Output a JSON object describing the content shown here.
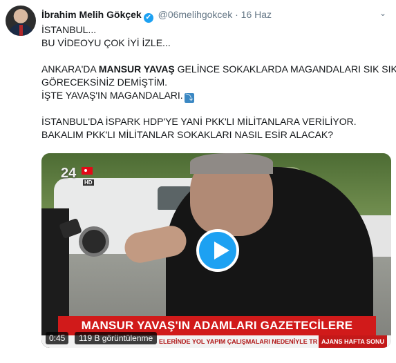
{
  "tweet": {
    "author_name": "İbrahim Melih Gökçek",
    "handle": "@06melihgokcek",
    "separator": "·",
    "date": "16 Haz",
    "verified_glyph": "✔",
    "menu_glyph": "⌄",
    "lines": [
      "İSTANBUL...",
      "BU VİDEOYU ÇOK İYİ İZLE...",
      "",
      "",
      "GÖRECEKSİNİZ DEMİŞTİM.",
      "İŞTE YAVAŞ'IN MAGANDALARI.",
      "",
      "İSTANBUL'DA İSPARK HDP'YE YANİ PKK'LI MİLİTANLARA VERİLİYOR.",
      "BAKALIM PKK'LI MİLİTANLAR SOKAKLARI NASIL ESİR ALACAK?"
    ],
    "line3_prefix": "ANKARA'DA ",
    "line3_bold": "MANSUR YAVAŞ",
    "line3_suffix": " GELİNCE SOKAKLARDA MAGANDALARI SIK SIK",
    "emoji_glyph": "⤵"
  },
  "video": {
    "channel_number": "24",
    "channel_hd": "HD",
    "headline": "MANSUR YAVAŞ'IN ADAMLARI GAZETECİLERE SALDIRDI",
    "ticker_text": "ELERİNDE YOL YAPIM ÇALIŞMALARI NEDENİYLE TR",
    "ticker_tag": "AJANS HAFTA SONU",
    "duration": "0:45",
    "views": "119 B görüntülenme"
  },
  "colors": {
    "accent": "#1da1f2",
    "headline_red": "#d11a1a",
    "muted": "#657786"
  },
  "icons": {
    "verified": "verified-badge-icon",
    "menu": "chevron-down-icon",
    "play": "play-icon",
    "emoji": "arrow-down-emoji-icon"
  }
}
